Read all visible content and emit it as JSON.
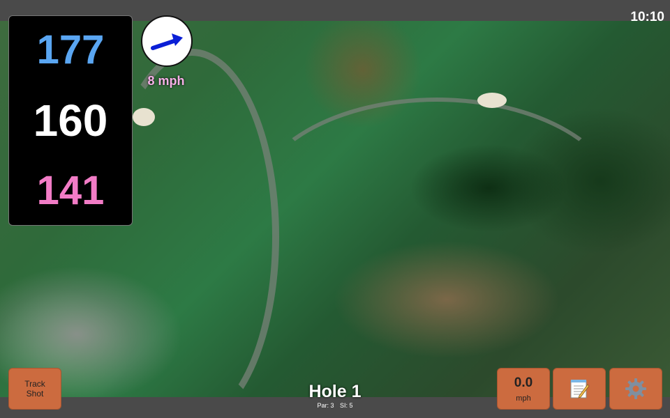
{
  "status": {
    "time": "10:10"
  },
  "distances": {
    "back": "177",
    "center": "160",
    "front": "141"
  },
  "wind": {
    "speed": "8 mph",
    "direction_icon": "arrow-icon"
  },
  "buttons": {
    "track_shot_line1": "Track",
    "track_shot_line2": "Shot",
    "speed_value": "0.0",
    "speed_unit": "mph",
    "notes_icon": "notepad-icon",
    "settings_icon": "gear-icon"
  },
  "hole": {
    "title": "Hole 1",
    "par": "Par: 3",
    "si": "SI: 5"
  },
  "colors": {
    "back_distance": "#5aa6f2",
    "center_distance": "#ffffff",
    "front_distance": "#f27cc6",
    "button": "#cc6b3f"
  }
}
